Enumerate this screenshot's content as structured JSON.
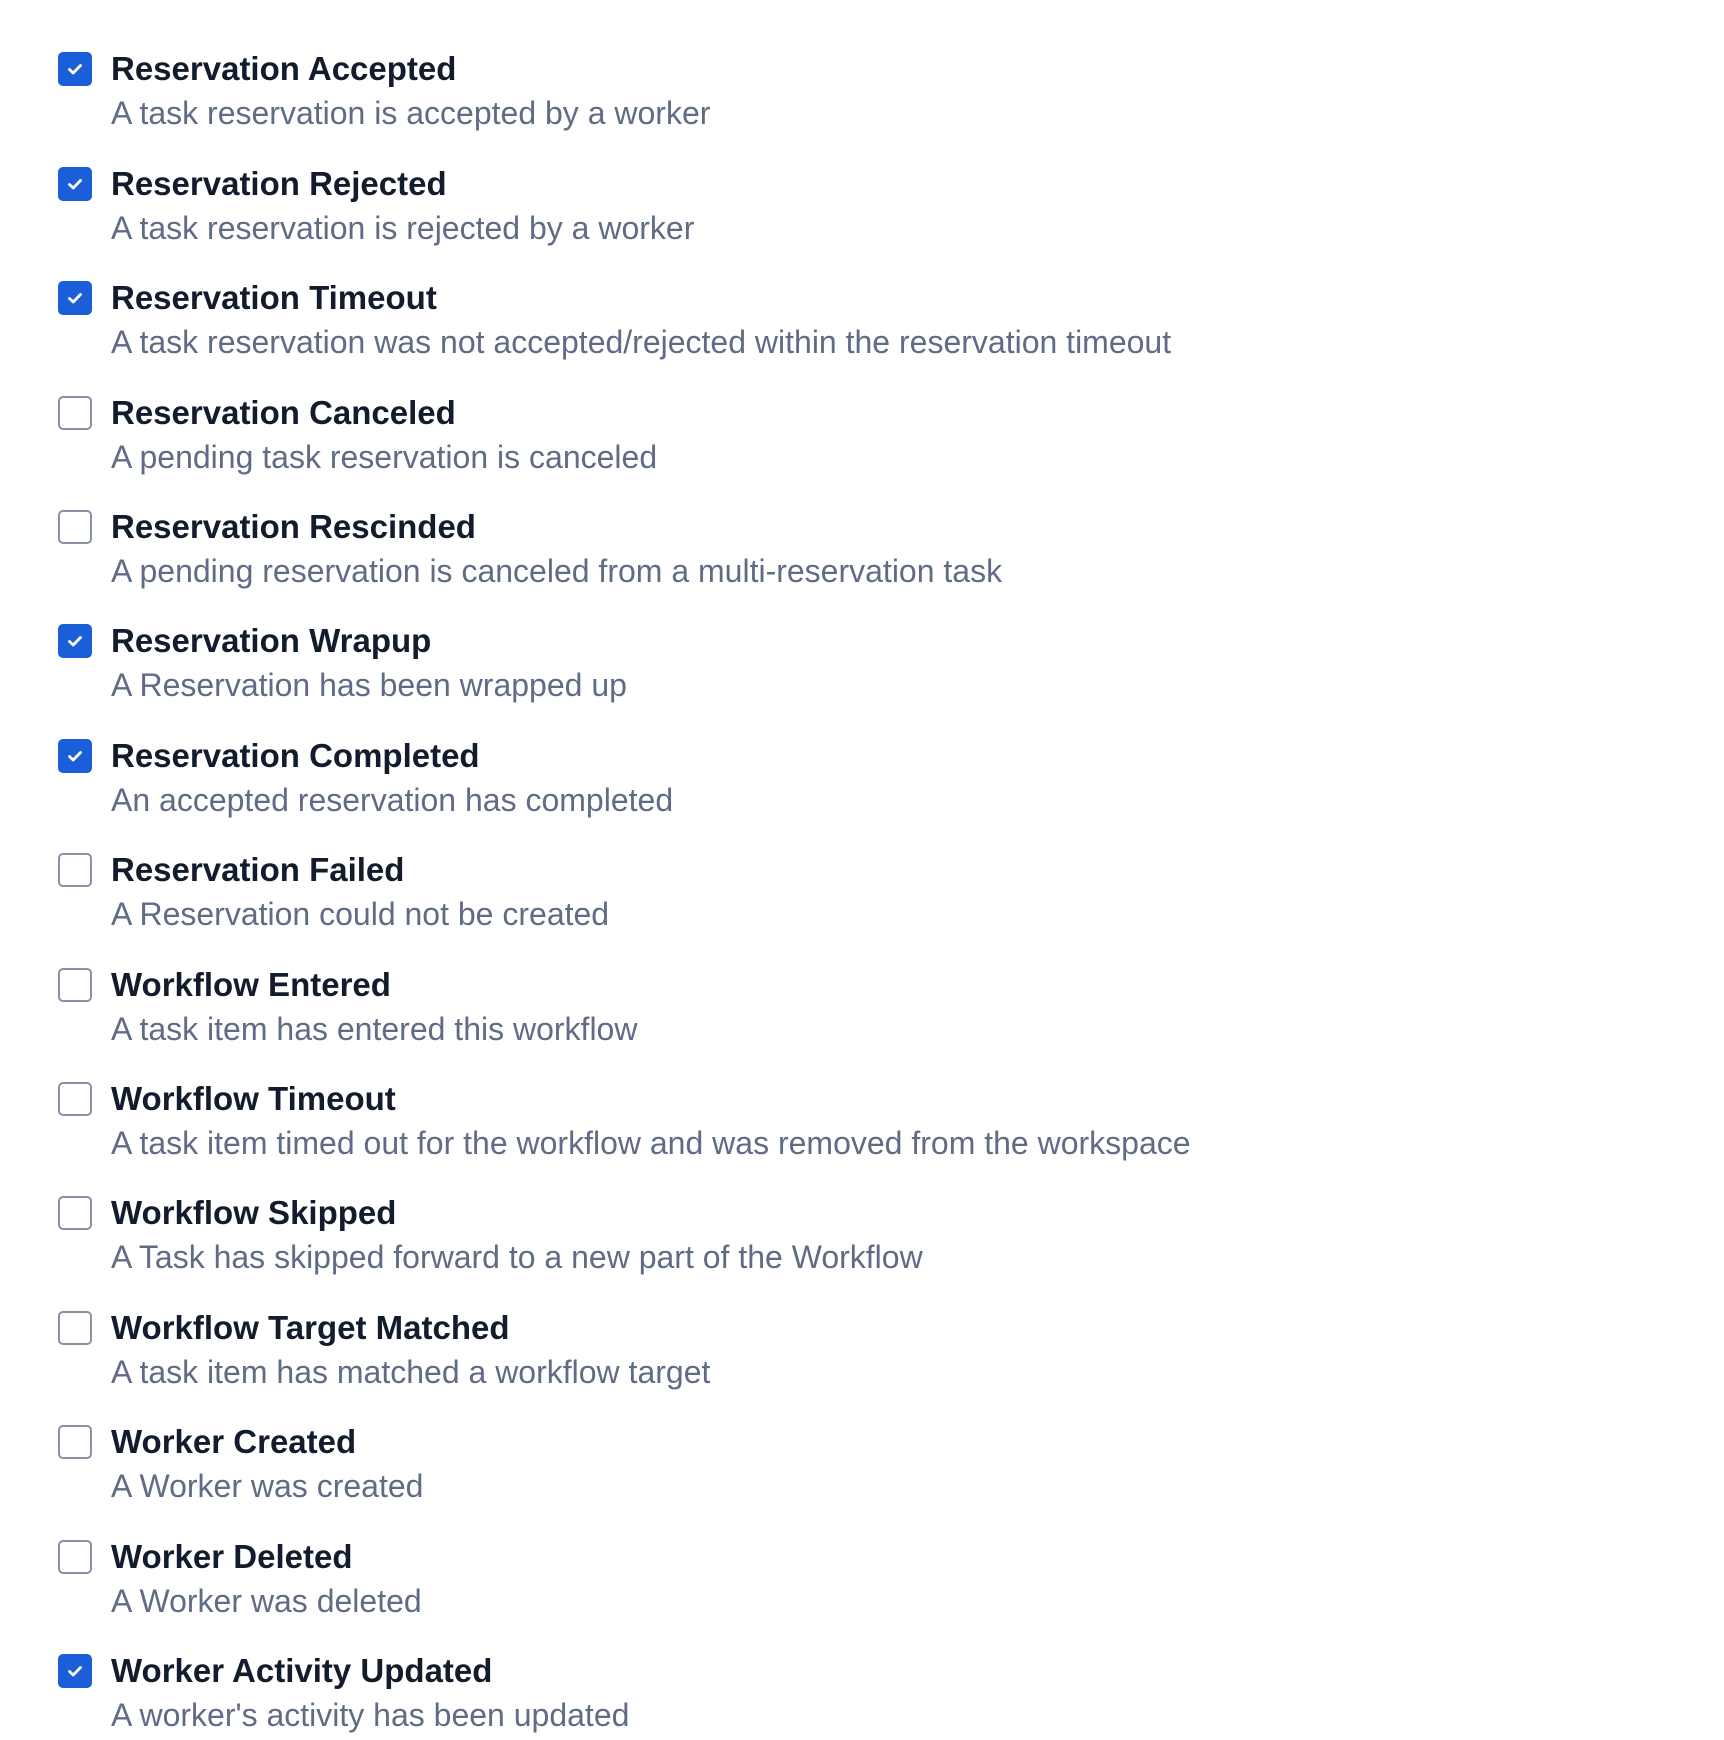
{
  "colors": {
    "checkbox_checked": "#1a5ed8",
    "checkbox_border": "#8891a7",
    "title_text": "#121c2d",
    "description_text": "#606b85"
  },
  "events": [
    {
      "title": "Reservation Accepted",
      "description": "A task reservation is accepted by a worker",
      "checked": true
    },
    {
      "title": "Reservation Rejected",
      "description": "A task reservation is rejected by a worker",
      "checked": true
    },
    {
      "title": "Reservation Timeout",
      "description": "A task reservation was not accepted/rejected within the reservation timeout",
      "checked": true
    },
    {
      "title": "Reservation Canceled",
      "description": "A pending task reservation is canceled",
      "checked": false
    },
    {
      "title": "Reservation Rescinded",
      "description": "A pending reservation is canceled from a multi-reservation task",
      "checked": false
    },
    {
      "title": "Reservation Wrapup",
      "description": "A Reservation has been wrapped up",
      "checked": true
    },
    {
      "title": "Reservation Completed",
      "description": "An accepted reservation has completed",
      "checked": true
    },
    {
      "title": "Reservation Failed",
      "description": "A Reservation could not be created",
      "checked": false
    },
    {
      "title": "Workflow Entered",
      "description": "A task item has entered this workflow",
      "checked": false
    },
    {
      "title": "Workflow Timeout",
      "description": "A task item timed out for the workflow and was removed from the workspace",
      "checked": false
    },
    {
      "title": "Workflow Skipped",
      "description": "A Task has skipped forward to a new part of the Workflow",
      "checked": false
    },
    {
      "title": "Workflow Target Matched",
      "description": "A task item has matched a workflow target",
      "checked": false
    },
    {
      "title": "Worker Created",
      "description": "A Worker was created",
      "checked": false
    },
    {
      "title": "Worker Deleted",
      "description": "A Worker was deleted",
      "checked": false
    },
    {
      "title": "Worker Activity Updated",
      "description": "A worker's activity has been updated",
      "checked": true
    }
  ]
}
